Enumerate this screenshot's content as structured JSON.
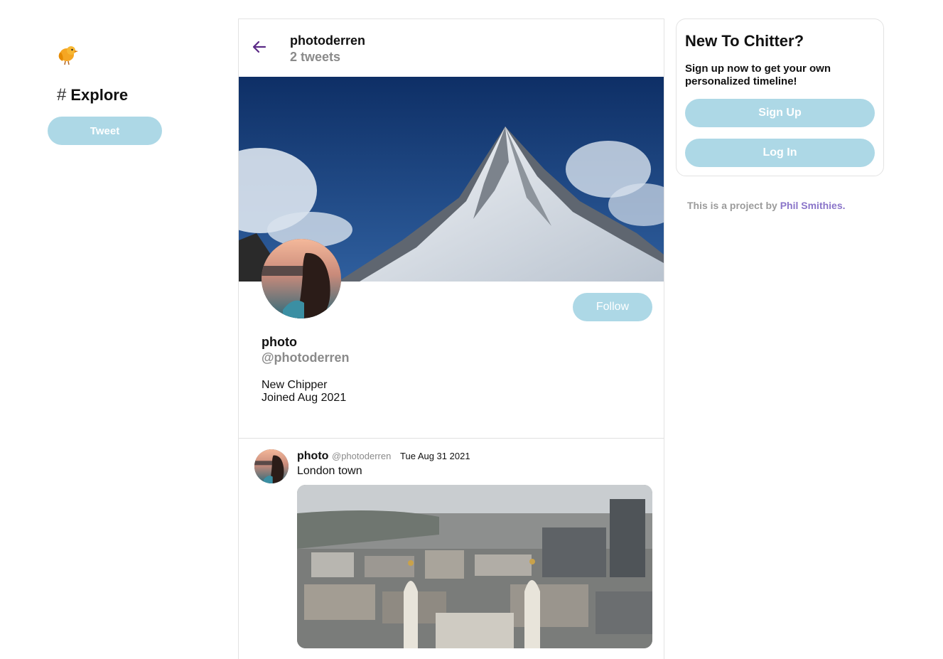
{
  "sidebar": {
    "logo_icon": "bird-icon",
    "explore_icon": "hashtag-icon",
    "explore_hash": "#",
    "explore_label": "Explore",
    "tweet_button_label": "Tweet"
  },
  "header": {
    "back_icon": "arrow-left-icon",
    "username": "photoderren",
    "tweet_count": "2 tweets"
  },
  "profile": {
    "display_name": "photo",
    "handle": "@photoderren",
    "bio": "New Chipper",
    "joined": "Joined Aug 2021",
    "follow_label": "Follow"
  },
  "tweets": [
    {
      "name": "photo",
      "handle": "@photoderren",
      "date": "Tue Aug 31 2021",
      "text": "London town"
    }
  ],
  "signup_card": {
    "title": "New To Chitter?",
    "subtitle": "Sign up now to get your own personalized timeline!",
    "signup_label": "Sign Up",
    "login_label": "Log In"
  },
  "footer": {
    "prefix": "This is a project by ",
    "author_link": "Phil Smithies."
  },
  "colors": {
    "accent_button": "#add8e6",
    "link_purple": "#8a75c9",
    "muted_text": "#8a8a8a"
  }
}
